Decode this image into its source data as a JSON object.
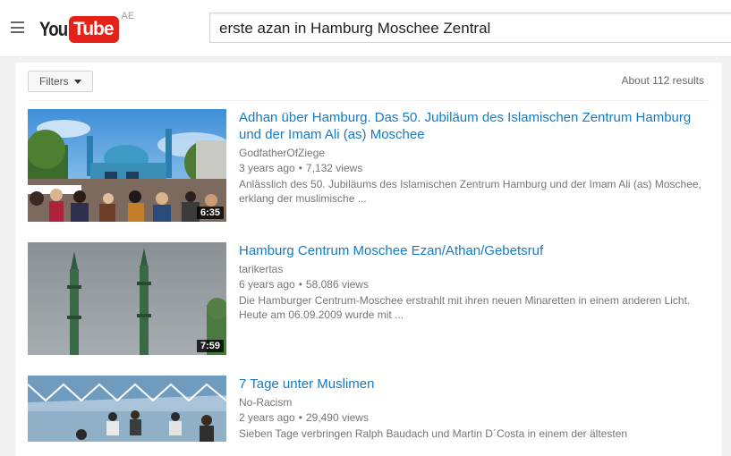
{
  "header": {
    "logo_you": "You",
    "logo_tube": "Tube",
    "region": "AE",
    "search_query": "erste azan in Hamburg Moschee Zentral"
  },
  "toolbar": {
    "filters_label": "Filters",
    "results_count": "About 112 results"
  },
  "results": [
    {
      "title": "Adhan über Hamburg. Das 50. Jubiläum des Islamischen Zentrum Hamburg und der Imam Ali (as) Moschee",
      "channel": "GodfatherOfZiege",
      "age": "3 years ago",
      "views": "7,132 views",
      "description": "Anlässlich des 50. Jubiläums des Islamischen Zentrum Hamburg und der Imam Ali (as) Moschee, erklang der muslimische ...",
      "duration": "6:35"
    },
    {
      "title": "Hamburg Centrum Moschee Ezan/Athan/Gebetsruf",
      "channel": "tarikertas",
      "age": "6 years ago",
      "views": "58,086 views",
      "description": "Die Hamburger Centrum-Moschee erstrahlt mit ihren neuen Minaretten in einem anderen Licht. Heute am 06.09.2009 wurde mit ...",
      "duration": "7:59"
    },
    {
      "title": "7 Tage unter Muslimen",
      "channel": "No-Racism",
      "age": "2 years ago",
      "views": "29,490 views",
      "description": "Sieben Tage verbringen Ralph Baudach und Martin D´Costa in einem der ältesten",
      "duration": ""
    }
  ],
  "colors": {
    "link": "#167ac6",
    "brand_red": "#e62117",
    "meta_text": "#767676"
  }
}
